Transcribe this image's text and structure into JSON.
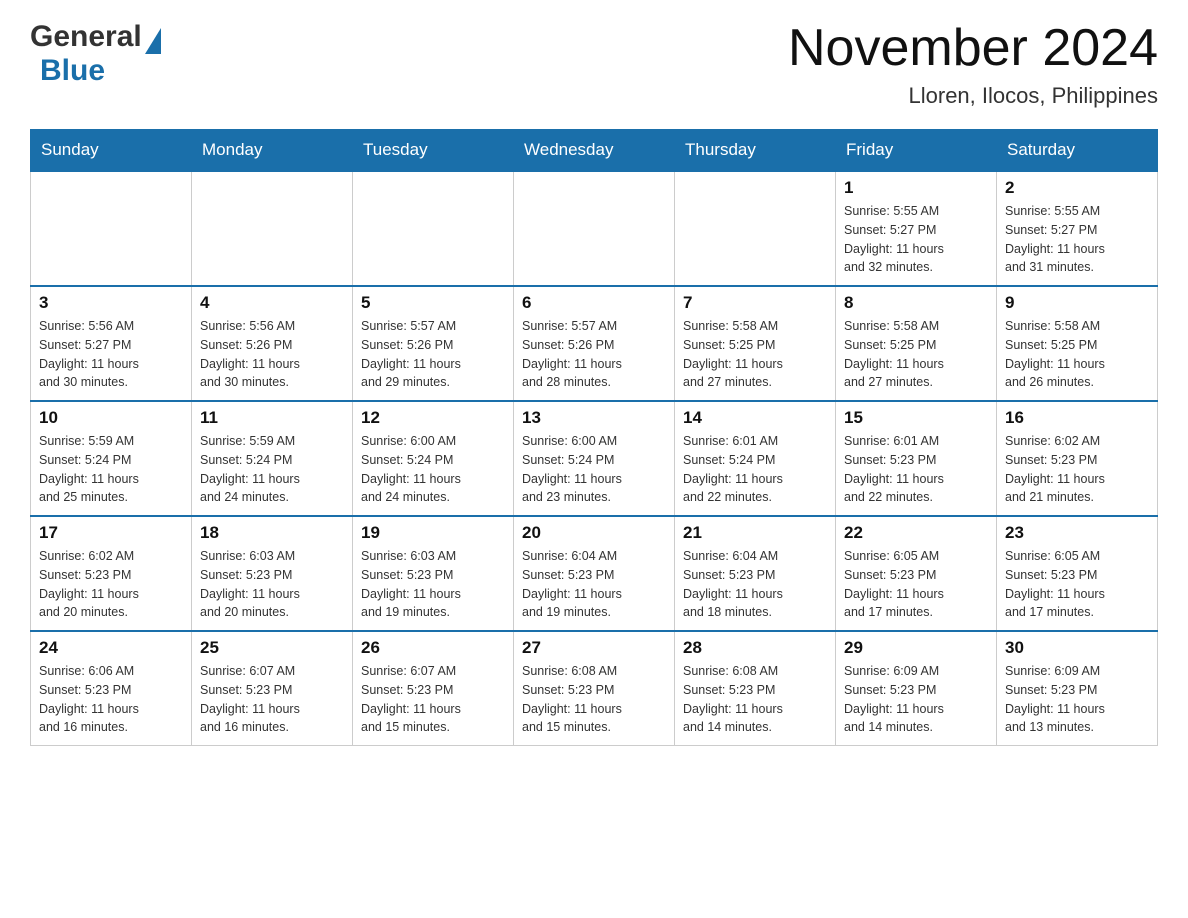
{
  "header": {
    "logo_general": "General",
    "logo_blue": "Blue",
    "month_title": "November 2024",
    "location": "Lloren, Ilocos, Philippines"
  },
  "weekdays": [
    "Sunday",
    "Monday",
    "Tuesday",
    "Wednesday",
    "Thursday",
    "Friday",
    "Saturday"
  ],
  "weeks": [
    [
      {
        "day": "",
        "info": ""
      },
      {
        "day": "",
        "info": ""
      },
      {
        "day": "",
        "info": ""
      },
      {
        "day": "",
        "info": ""
      },
      {
        "day": "",
        "info": ""
      },
      {
        "day": "1",
        "info": "Sunrise: 5:55 AM\nSunset: 5:27 PM\nDaylight: 11 hours\nand 32 minutes."
      },
      {
        "day": "2",
        "info": "Sunrise: 5:55 AM\nSunset: 5:27 PM\nDaylight: 11 hours\nand 31 minutes."
      }
    ],
    [
      {
        "day": "3",
        "info": "Sunrise: 5:56 AM\nSunset: 5:27 PM\nDaylight: 11 hours\nand 30 minutes."
      },
      {
        "day": "4",
        "info": "Sunrise: 5:56 AM\nSunset: 5:26 PM\nDaylight: 11 hours\nand 30 minutes."
      },
      {
        "day": "5",
        "info": "Sunrise: 5:57 AM\nSunset: 5:26 PM\nDaylight: 11 hours\nand 29 minutes."
      },
      {
        "day": "6",
        "info": "Sunrise: 5:57 AM\nSunset: 5:26 PM\nDaylight: 11 hours\nand 28 minutes."
      },
      {
        "day": "7",
        "info": "Sunrise: 5:58 AM\nSunset: 5:25 PM\nDaylight: 11 hours\nand 27 minutes."
      },
      {
        "day": "8",
        "info": "Sunrise: 5:58 AM\nSunset: 5:25 PM\nDaylight: 11 hours\nand 27 minutes."
      },
      {
        "day": "9",
        "info": "Sunrise: 5:58 AM\nSunset: 5:25 PM\nDaylight: 11 hours\nand 26 minutes."
      }
    ],
    [
      {
        "day": "10",
        "info": "Sunrise: 5:59 AM\nSunset: 5:24 PM\nDaylight: 11 hours\nand 25 minutes."
      },
      {
        "day": "11",
        "info": "Sunrise: 5:59 AM\nSunset: 5:24 PM\nDaylight: 11 hours\nand 24 minutes."
      },
      {
        "day": "12",
        "info": "Sunrise: 6:00 AM\nSunset: 5:24 PM\nDaylight: 11 hours\nand 24 minutes."
      },
      {
        "day": "13",
        "info": "Sunrise: 6:00 AM\nSunset: 5:24 PM\nDaylight: 11 hours\nand 23 minutes."
      },
      {
        "day": "14",
        "info": "Sunrise: 6:01 AM\nSunset: 5:24 PM\nDaylight: 11 hours\nand 22 minutes."
      },
      {
        "day": "15",
        "info": "Sunrise: 6:01 AM\nSunset: 5:23 PM\nDaylight: 11 hours\nand 22 minutes."
      },
      {
        "day": "16",
        "info": "Sunrise: 6:02 AM\nSunset: 5:23 PM\nDaylight: 11 hours\nand 21 minutes."
      }
    ],
    [
      {
        "day": "17",
        "info": "Sunrise: 6:02 AM\nSunset: 5:23 PM\nDaylight: 11 hours\nand 20 minutes."
      },
      {
        "day": "18",
        "info": "Sunrise: 6:03 AM\nSunset: 5:23 PM\nDaylight: 11 hours\nand 20 minutes."
      },
      {
        "day": "19",
        "info": "Sunrise: 6:03 AM\nSunset: 5:23 PM\nDaylight: 11 hours\nand 19 minutes."
      },
      {
        "day": "20",
        "info": "Sunrise: 6:04 AM\nSunset: 5:23 PM\nDaylight: 11 hours\nand 19 minutes."
      },
      {
        "day": "21",
        "info": "Sunrise: 6:04 AM\nSunset: 5:23 PM\nDaylight: 11 hours\nand 18 minutes."
      },
      {
        "day": "22",
        "info": "Sunrise: 6:05 AM\nSunset: 5:23 PM\nDaylight: 11 hours\nand 17 minutes."
      },
      {
        "day": "23",
        "info": "Sunrise: 6:05 AM\nSunset: 5:23 PM\nDaylight: 11 hours\nand 17 minutes."
      }
    ],
    [
      {
        "day": "24",
        "info": "Sunrise: 6:06 AM\nSunset: 5:23 PM\nDaylight: 11 hours\nand 16 minutes."
      },
      {
        "day": "25",
        "info": "Sunrise: 6:07 AM\nSunset: 5:23 PM\nDaylight: 11 hours\nand 16 minutes."
      },
      {
        "day": "26",
        "info": "Sunrise: 6:07 AM\nSunset: 5:23 PM\nDaylight: 11 hours\nand 15 minutes."
      },
      {
        "day": "27",
        "info": "Sunrise: 6:08 AM\nSunset: 5:23 PM\nDaylight: 11 hours\nand 15 minutes."
      },
      {
        "day": "28",
        "info": "Sunrise: 6:08 AM\nSunset: 5:23 PM\nDaylight: 11 hours\nand 14 minutes."
      },
      {
        "day": "29",
        "info": "Sunrise: 6:09 AM\nSunset: 5:23 PM\nDaylight: 11 hours\nand 14 minutes."
      },
      {
        "day": "30",
        "info": "Sunrise: 6:09 AM\nSunset: 5:23 PM\nDaylight: 11 hours\nand 13 minutes."
      }
    ]
  ]
}
